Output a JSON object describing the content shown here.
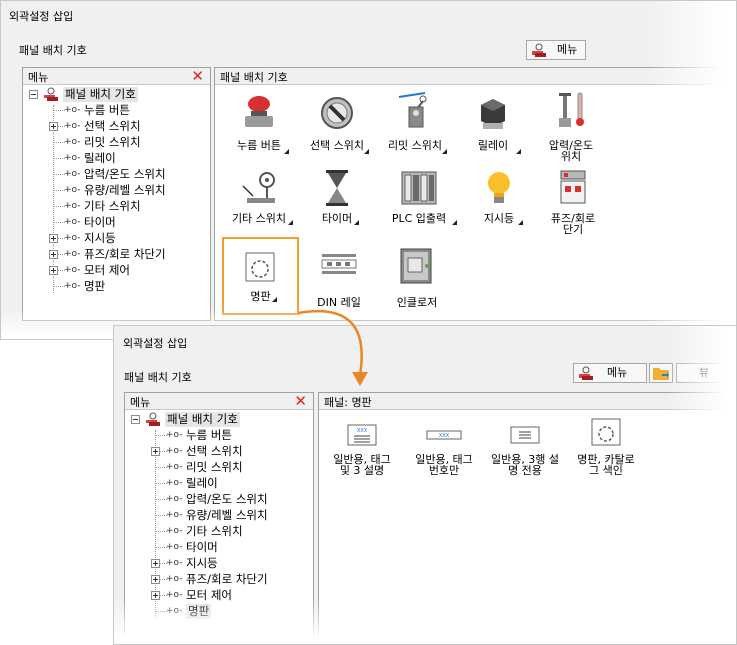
{
  "back": {
    "title": "외곽설정 삽입",
    "subheader": "패널 배치 기호",
    "toolbar": {
      "menu_label": "메뉴"
    },
    "left_pane": {
      "header": "메뉴"
    },
    "right_pane": {
      "header": "패널 배치 기호"
    },
    "tree": [
      "패널 배치 기호",
      "누름 버튼",
      "선택 스위치",
      "리밋 스위치",
      "릴레이",
      "압력/온도 스위치",
      "유량/레벨 스위치",
      "기타 스위치",
      "타이머",
      "지시등",
      "퓨즈/회로 차단기",
      "모터 제어",
      "명판"
    ],
    "symbols": [
      [
        "누름 버튼"
      ],
      [
        "선택 스위치"
      ],
      [
        "리밋 스위치"
      ],
      [
        "릴레이"
      ],
      [
        "압력/온도",
        "위치"
      ],
      [
        "기타 스위치"
      ],
      [
        "타이머"
      ],
      [
        "PLC 입출력"
      ],
      [
        "지시등"
      ],
      [
        "퓨즈/회로",
        "단기"
      ],
      [
        "명판"
      ],
      [
        "DIN 레일"
      ],
      [
        "인클로저"
      ]
    ]
  },
  "front": {
    "title": "외곽설정 삽입",
    "subheader": "패널 배치 기호",
    "toolbar": {
      "menu_label": "메뉴",
      "view_label": "뷰"
    },
    "left_pane": {
      "header": "메뉴"
    },
    "right_pane": {
      "header": "패널: 명판"
    },
    "tree": [
      "패널 배치 기호",
      "누름 버튼",
      "선택 스위치",
      "리밋 스위치",
      "릴레이",
      "압력/온도 스위치",
      "유량/레벨 스위치",
      "기타 스위치",
      "타이머",
      "지시등",
      "퓨즈/회로 차단기",
      "모터 제어",
      "명판"
    ],
    "symbols": [
      [
        "일반용, 태그",
        "및 3 설명"
      ],
      [
        "일반용, 태그",
        "번호만"
      ],
      [
        "일반용, 3행 설",
        "명 전용"
      ],
      [
        "명판, 카탈로",
        "그 색인"
      ]
    ]
  },
  "colors": {
    "highlight": "#f0a030",
    "arrow": "#e9862a",
    "close": "#e32222",
    "selected_item": "#e5e5e5"
  }
}
